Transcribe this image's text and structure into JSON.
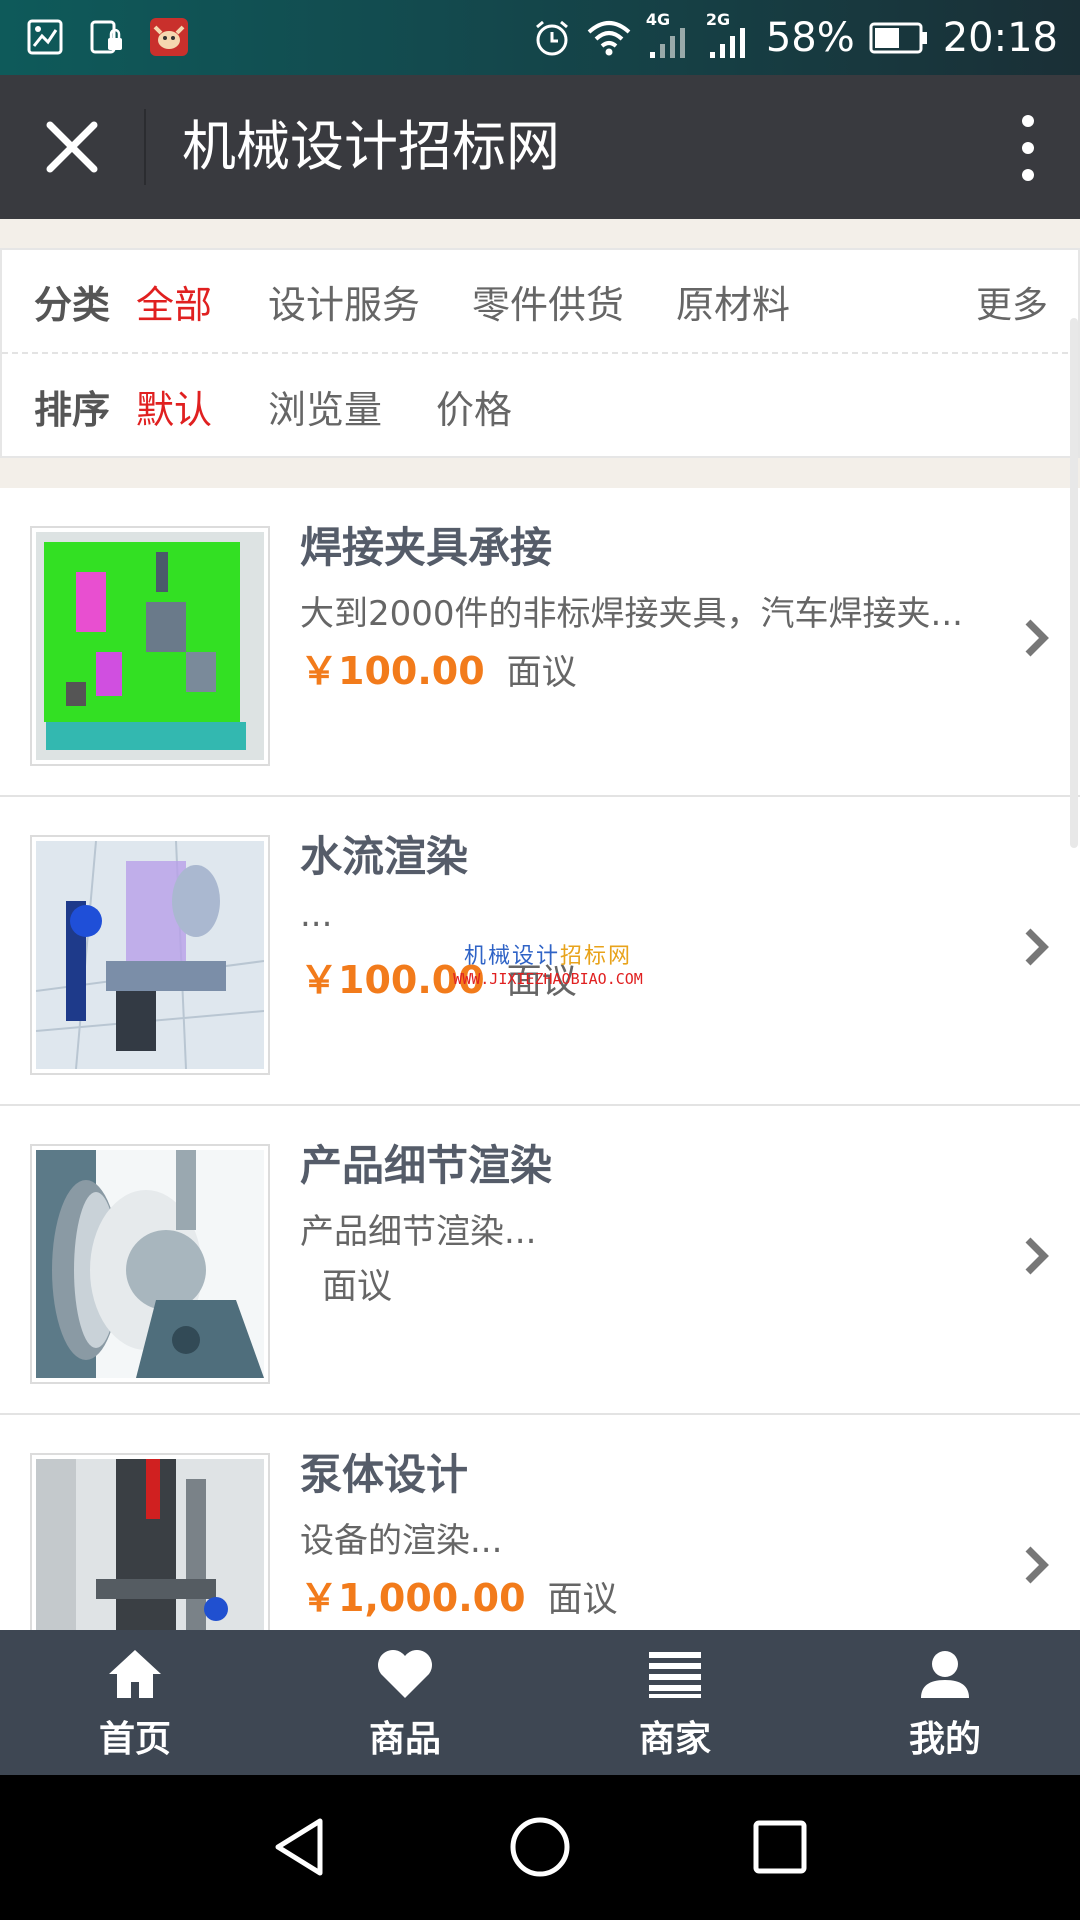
{
  "status_bar": {
    "battery": "58%",
    "time": "20:18",
    "net1": "4G",
    "net2": "2G"
  },
  "titlebar": {
    "title": "机械设计招标网"
  },
  "filter": {
    "category_label": "分类",
    "categories": [
      "全部",
      "设计服务",
      "零件供货",
      "原材料"
    ],
    "more": "更多",
    "sort_label": "排序",
    "sorts": [
      "默认",
      "浏览量",
      "价格"
    ]
  },
  "items": [
    {
      "title": "焊接夹具承接",
      "desc": "大到2000件的非标焊接夹具，汽车焊接夹...",
      "price": "￥100.00",
      "nego": "面议"
    },
    {
      "title": "水流渲染",
      "desc": "...",
      "price": "￥100.00",
      "nego": "面议"
    },
    {
      "title": "产品细节渲染",
      "desc": "产品细节渲染...",
      "price": "",
      "nego": "面议"
    },
    {
      "title": "泵体设计",
      "desc": "设备的渲染...",
      "price": "￥1,000.00",
      "nego": "面议"
    }
  ],
  "watermark": {
    "line1a": "机械设计",
    "line1b": "招标网",
    "line2": "WWW.JIXIEZHAOBIAO.COM"
  },
  "bottom_nav": [
    "首页",
    "商品",
    "商家",
    "我的"
  ],
  "colors": {
    "accent_red": "#e02020",
    "price_orange": "#f27b1b",
    "nav_bg": "#3e4753",
    "titlebar_bg": "#393a3f"
  }
}
